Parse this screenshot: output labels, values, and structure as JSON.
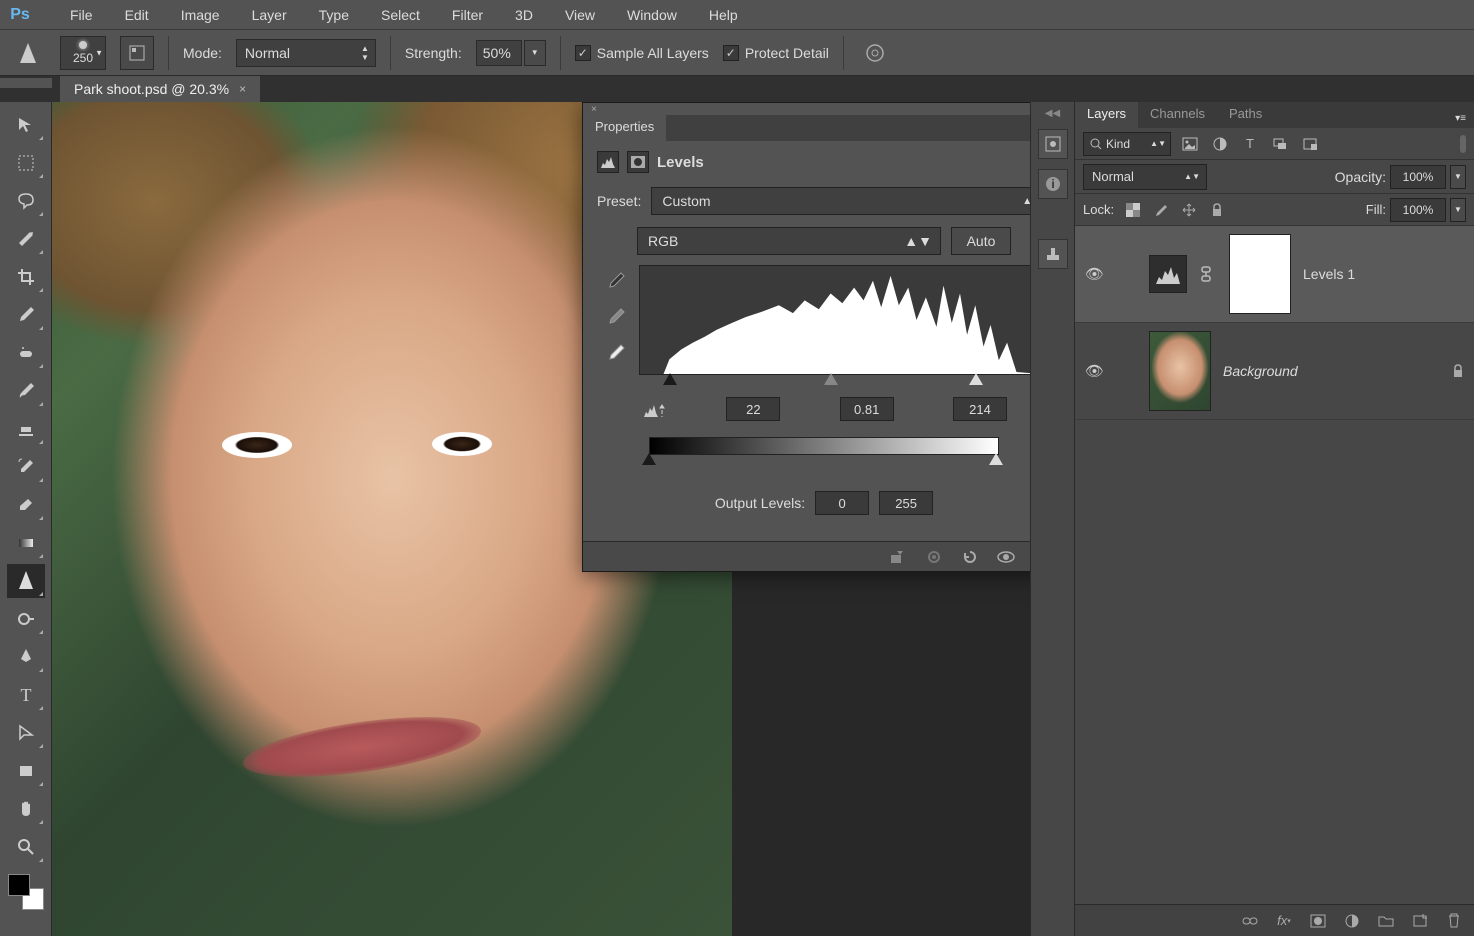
{
  "menu": [
    "File",
    "Edit",
    "Image",
    "Layer",
    "Type",
    "Select",
    "Filter",
    "3D",
    "View",
    "Window",
    "Help"
  ],
  "options": {
    "brush_size": "250",
    "mode_label": "Mode:",
    "mode_value": "Normal",
    "strength_label": "Strength:",
    "strength_value": "50%",
    "sample_all": "Sample All Layers",
    "protect": "Protect Detail"
  },
  "document": {
    "tab": "Park shoot.psd @ 20.3%"
  },
  "properties": {
    "title": "Properties",
    "adj_name": "Levels",
    "preset_label": "Preset:",
    "preset_value": "Custom",
    "channel": "RGB",
    "auto": "Auto",
    "input_black": "22",
    "input_gamma": "0.81",
    "input_white": "214",
    "output_label": "Output Levels:",
    "output_black": "0",
    "output_white": "255"
  },
  "layers_panel": {
    "tabs": [
      "Layers",
      "Channels",
      "Paths"
    ],
    "kind": "Kind",
    "blend": "Normal",
    "opacity_label": "Opacity:",
    "opacity": "100%",
    "lock_label": "Lock:",
    "fill_label": "Fill:",
    "fill": "100%",
    "layers": [
      {
        "name": "Levels 1"
      },
      {
        "name": "Background"
      }
    ]
  }
}
